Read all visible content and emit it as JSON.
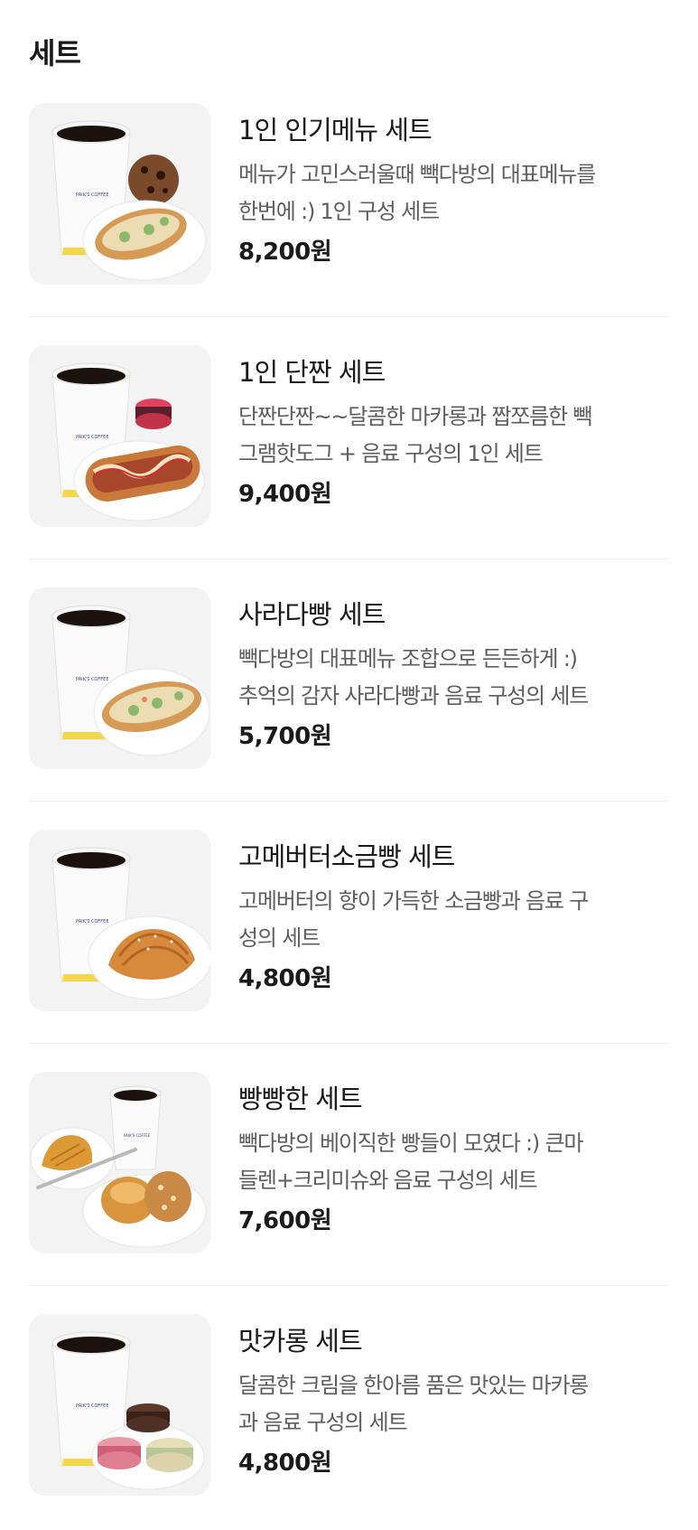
{
  "section": {
    "title": "세트"
  },
  "items": [
    {
      "name": "1인 인기메뉴 세트",
      "desc_lines": [
        "메뉴가 고민스러울때 빽다방의 대표메뉴를",
        "한번에 :) 1인 구성 세트"
      ],
      "price": "8,200원",
      "image": "coffee-cookie-sandwich",
      "image_label": "PAIK'S COFFEE"
    },
    {
      "name": "1인 단짠 세트",
      "desc_lines": [
        "단짠단짠~~달콤한 마카롱과 짭쪼름한 빽",
        "그램핫도그 + 음료 구성의 1인 세트"
      ],
      "price": "9,400원",
      "image": "coffee-macaron-hotdog",
      "image_label": "PAIK'S COFFEE"
    },
    {
      "name": "사라다빵 세트",
      "desc_lines": [
        "빽다방의 대표메뉴 조합으로 든든하게 :)",
        "추억의 감자 사라다빵과 음료 구성의 세트"
      ],
      "price": "5,700원",
      "image": "coffee-salad-bread",
      "image_label": "PAIK'S COFFEE"
    },
    {
      "name": "고메버터소금빵 세트",
      "desc_lines": [
        "고메버터의 향이 가득한 소금빵과 음료 구",
        "성의 세트"
      ],
      "price": "4,800원",
      "image": "coffee-salt-bread",
      "image_label": "PAIK'S COFFEE"
    },
    {
      "name": "빵빵한 세트",
      "desc_lines": [
        "빽다방의 베이직한 빵들이 모였다 :) 큰마",
        "들렌+크리미슈와 음료 구성의 세트"
      ],
      "price": "7,600원",
      "image": "coffee-madeleine-cream-puff",
      "image_label": "PAIK'S COFFEE"
    },
    {
      "name": "맛카롱 세트",
      "desc_lines": [
        "달콤한 크림을 한아름 품은 맛있는 마카롱",
        "과 음료 구성의 세트"
      ],
      "price": "4,800원",
      "image": "coffee-macarons",
      "image_label": "PAIK'S COFFEE"
    }
  ]
}
